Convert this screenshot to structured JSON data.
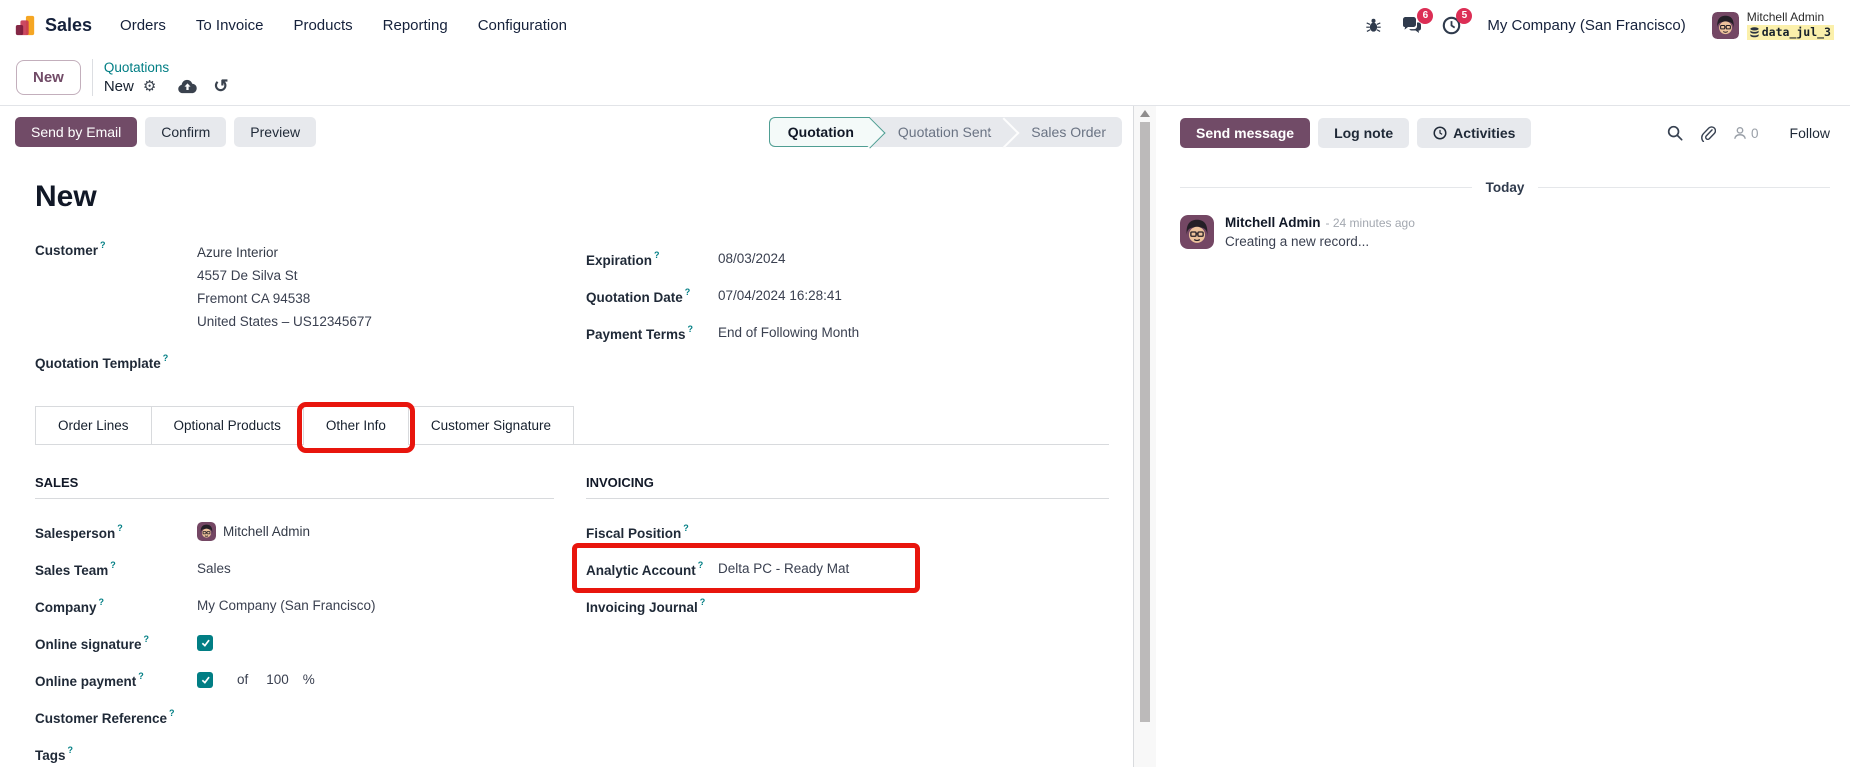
{
  "navbar": {
    "app_name": "Sales",
    "menu_items": [
      "Orders",
      "To Invoice",
      "Products",
      "Reporting",
      "Configuration"
    ],
    "messages_badge": "6",
    "activities_badge": "5",
    "company": "My Company (San Francisco)",
    "user_name": "Mitchell Admin",
    "database": "data_jul_3"
  },
  "breadcrumb": {
    "new_button": "New",
    "parent": "Quotations",
    "current": "New"
  },
  "icons": {
    "gear": "⚙",
    "undo": "↺"
  },
  "form": {
    "actions": {
      "send_by_email": "Send by Email",
      "confirm": "Confirm",
      "preview": "Preview"
    },
    "statusbar": [
      {
        "label": "Quotation",
        "active": true
      },
      {
        "label": "Quotation Sent",
        "active": false
      },
      {
        "label": "Sales Order",
        "active": false
      }
    ],
    "title": "New",
    "fields": {
      "customer": {
        "label": "Customer",
        "name": "Azure Interior",
        "address_line1": "4557 De Silva St",
        "address_line2": "Fremont CA 94538",
        "address_line3": "United States – US12345677"
      },
      "quotation_template": {
        "label": "Quotation Template",
        "value": ""
      },
      "expiration": {
        "label": "Expiration",
        "value": "08/03/2024"
      },
      "quotation_date": {
        "label": "Quotation Date",
        "value": "07/04/2024 16:28:41"
      },
      "payment_terms": {
        "label": "Payment Terms",
        "value": "End of Following Month"
      }
    },
    "tabs": [
      {
        "label": "Order Lines"
      },
      {
        "label": "Optional Products"
      },
      {
        "label": "Other Info",
        "active": true,
        "annotated": true
      },
      {
        "label": "Customer Signature"
      }
    ],
    "sales_section": {
      "title": "SALES",
      "salesperson": {
        "label": "Salesperson",
        "value": "Mitchell Admin"
      },
      "sales_team": {
        "label": "Sales Team",
        "value": "Sales"
      },
      "company": {
        "label": "Company",
        "value": "My Company (San Francisco)"
      },
      "online_signature": {
        "label": "Online signature",
        "checked": true
      },
      "online_payment": {
        "label": "Online payment",
        "checked": true,
        "of_label": "of",
        "amount": "100",
        "percent": "%"
      },
      "customer_reference": {
        "label": "Customer Reference",
        "value": ""
      },
      "tags": {
        "label": "Tags",
        "value": ""
      }
    },
    "invoicing_section": {
      "title": "INVOICING",
      "fiscal_position": {
        "label": "Fiscal Position",
        "value": ""
      },
      "analytic_account": {
        "label": "Analytic Account",
        "value": "Delta PC - Ready Mat",
        "annotated": true
      },
      "invoicing_journal": {
        "label": "Invoicing Journal",
        "value": ""
      }
    }
  },
  "chatter": {
    "send_message": "Send message",
    "log_note": "Log note",
    "activities": "Activities",
    "followers_count": "0",
    "follow": "Follow",
    "date_divider": "Today",
    "message": {
      "author": "Mitchell Admin",
      "time": "- 24 minutes ago",
      "body": "Creating a new record..."
    }
  },
  "colors": {
    "primary_purple": "#714B67",
    "accent_teal": "#017E84",
    "badge_red": "#DC2E55",
    "annotation_red": "#E8150D",
    "db_badge_bg": "#FBF0AB"
  }
}
